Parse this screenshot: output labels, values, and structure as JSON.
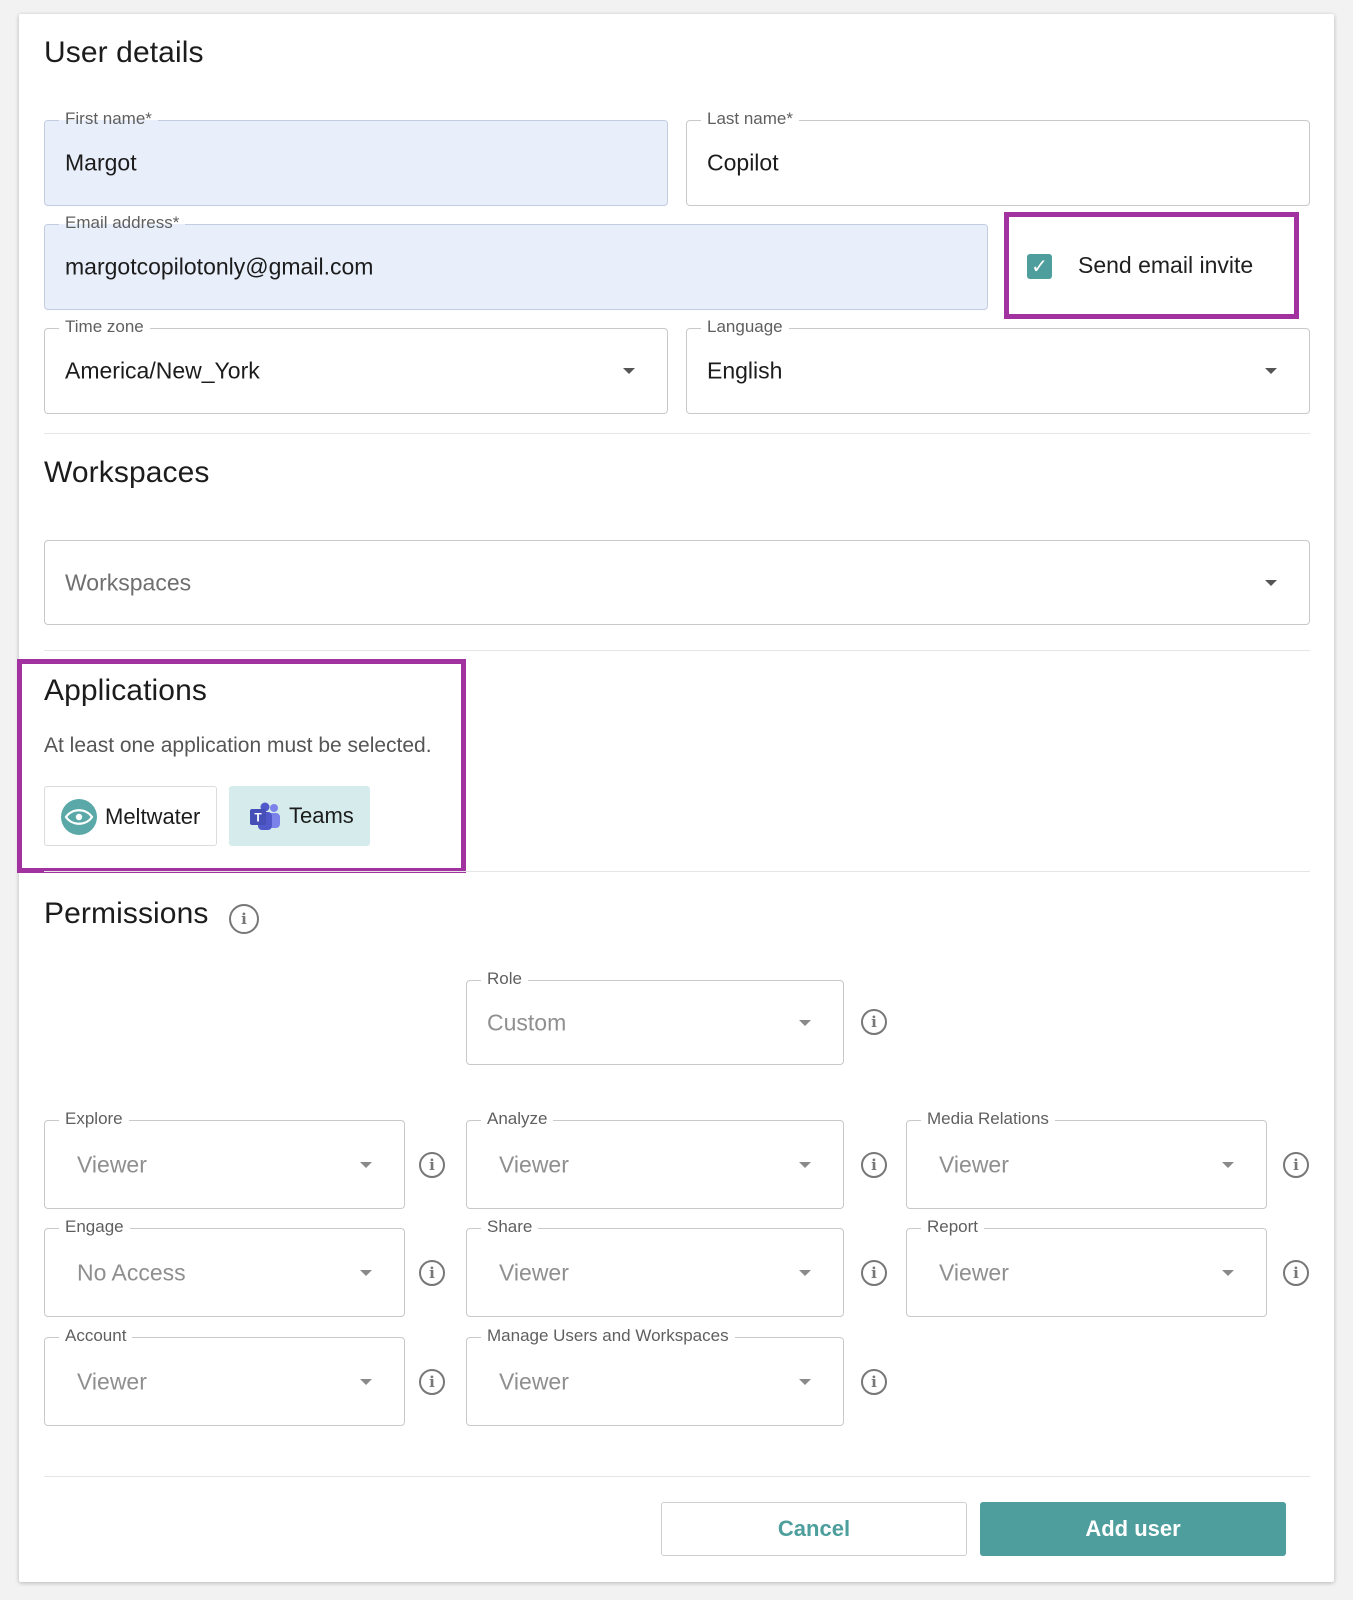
{
  "user_details": {
    "title": "User details",
    "first_name": {
      "label": "First name*",
      "value": "Margot"
    },
    "last_name": {
      "label": "Last name*",
      "value": "Copilot"
    },
    "email": {
      "label": "Email address*",
      "value": "margotcopilotonly@gmail.com"
    },
    "send_invite": {
      "label": "Send email invite",
      "checked": true
    },
    "time_zone": {
      "label": "Time zone",
      "value": "America/New_York"
    },
    "language": {
      "label": "Language",
      "value": "English"
    }
  },
  "workspaces": {
    "title": "Workspaces",
    "select_placeholder": "Workspaces"
  },
  "applications": {
    "title": "Applications",
    "hint": "At least one application must be selected.",
    "items": [
      {
        "label": "Meltwater",
        "icon": "meltwater-logo-icon",
        "selected": false
      },
      {
        "label": "Teams",
        "icon": "teams-logo-icon",
        "selected": true
      }
    ]
  },
  "permissions": {
    "title": "Permissions",
    "role": {
      "label": "Role",
      "value": "Custom"
    },
    "fields": [
      {
        "label": "Explore",
        "value": "Viewer"
      },
      {
        "label": "Analyze",
        "value": "Viewer"
      },
      {
        "label": "Media Relations",
        "value": "Viewer"
      },
      {
        "label": "Engage",
        "value": "No Access"
      },
      {
        "label": "Share",
        "value": "Viewer"
      },
      {
        "label": "Report",
        "value": "Viewer"
      },
      {
        "label": "Account",
        "value": "Viewer"
      },
      {
        "label": "Manage Users and Workspaces",
        "value": "Viewer"
      }
    ]
  },
  "actions": {
    "cancel": "Cancel",
    "add_user": "Add user"
  },
  "colors": {
    "accent": "#4d9e9c",
    "highlight": "#a2329f",
    "filled_field": "#e8effb",
    "selected_chip": "#d6ecec"
  }
}
